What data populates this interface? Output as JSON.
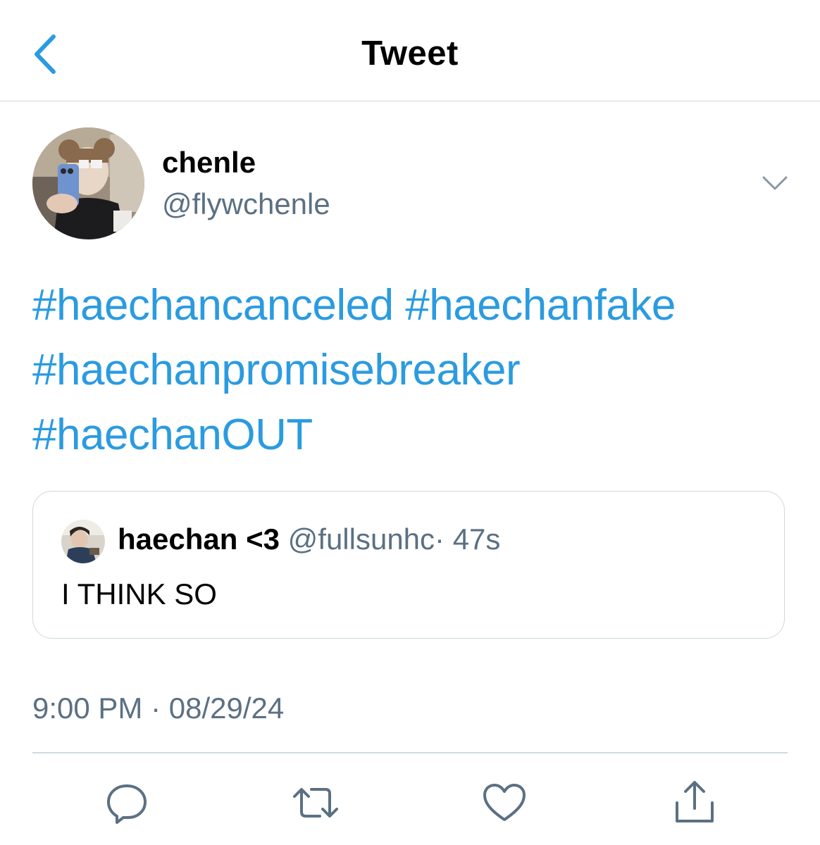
{
  "header": {
    "title": "Tweet"
  },
  "author": {
    "display_name": "chenle",
    "handle": "@flywchenle"
  },
  "tweet": {
    "hashtags": [
      "#haechancanceled",
      "#haechanfake",
      "#haechanpromisebreaker",
      "#haechanOUT"
    ],
    "timestamp": "9:00 PM · 08/29/24"
  },
  "quoted": {
    "display_name": "haechan <3",
    "handle": "@fullsunhc",
    "age": "· 47s",
    "text": "I THINK SO"
  },
  "colors": {
    "accent": "#2b9be0",
    "secondary_text": "#5b7083",
    "divider": "#cfd9de"
  },
  "icons": {
    "back": "chevron-left-icon",
    "more": "chevron-down-icon",
    "reply": "reply-icon",
    "retweet": "retweet-icon",
    "like": "heart-icon",
    "share": "share-icon"
  }
}
